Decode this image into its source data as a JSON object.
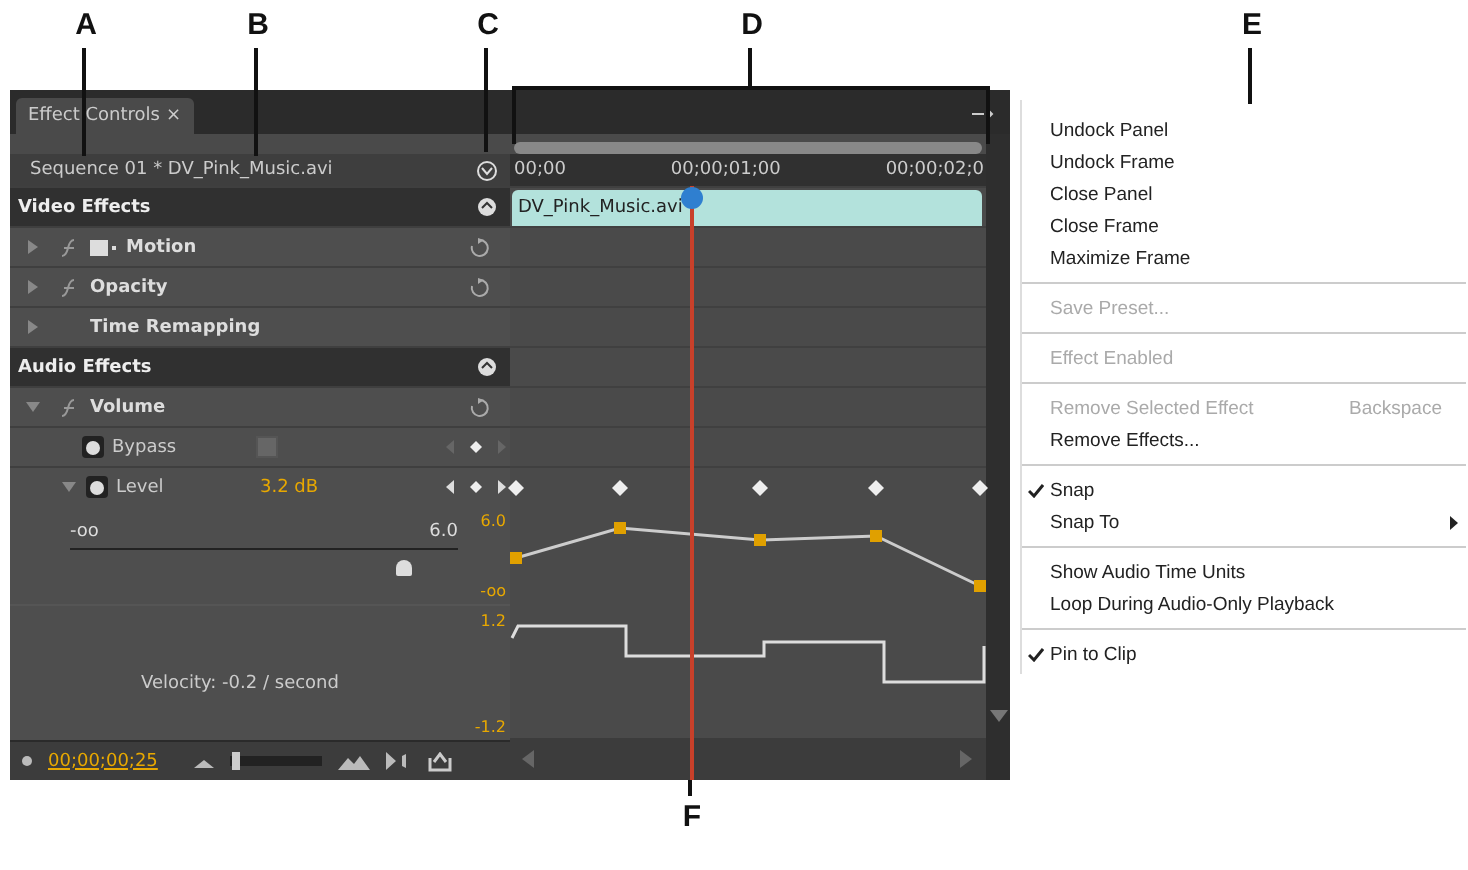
{
  "callouts": [
    {
      "label": "A"
    },
    {
      "label": "B"
    },
    {
      "label": "C"
    },
    {
      "label": "D"
    },
    {
      "label": "E"
    },
    {
      "label": "F"
    }
  ],
  "panel": {
    "tab": {
      "label": "Effect Controls",
      "close": "×",
      "selected": true
    },
    "source": "Sequence 01 * DV_Pink_Music.avi",
    "rows": [
      {
        "kind": "section",
        "label": "Video Effects"
      },
      {
        "kind": "effect",
        "label": "Motion",
        "expanded": false,
        "fx": true,
        "transform": true,
        "reset": true
      },
      {
        "kind": "effect",
        "label": "Opacity",
        "expanded": false,
        "fx": true,
        "transform": false,
        "reset": true
      },
      {
        "kind": "effect",
        "label": "Time Remapping",
        "expanded": false,
        "fx": false,
        "transform": false,
        "reset": false
      },
      {
        "kind": "section",
        "label": "Audio Effects"
      },
      {
        "kind": "effect",
        "label": "Volume",
        "expanded": true,
        "fx": true,
        "transform": false,
        "reset": true
      },
      {
        "kind": "checkbox",
        "label": "Bypass",
        "checked": false
      },
      {
        "kind": "param",
        "label": "Level",
        "value": "3.2 dB",
        "expanded": true
      }
    ],
    "slider": {
      "min": "-oo",
      "max": "6.0",
      "level": 0.86
    },
    "scale": {
      "value_max": "6.0",
      "value_min": "-oo",
      "velocity_max": "1.2",
      "velocity_min": "-1.2"
    },
    "velocity": "Velocity: -0.2 / second",
    "timecode": "00;00;00;25",
    "zoom": {
      "level": 0.03
    },
    "timeline": {
      "ruler": [
        "00;00",
        "00;00;01;00",
        "00;00;02;0"
      ],
      "clip": "DV_Pink_Music.avi"
    }
  },
  "menu": {
    "groups": [
      [
        {
          "label": "Undock Panel",
          "disabled": false,
          "checked": false
        },
        {
          "label": "Undock Frame",
          "disabled": false,
          "checked": false
        },
        {
          "label": "Close Panel",
          "disabled": false,
          "checked": false
        },
        {
          "label": "Close Frame",
          "disabled": false,
          "checked": false
        },
        {
          "label": "Maximize Frame",
          "disabled": false,
          "checked": false
        }
      ],
      [
        {
          "label": "Save Preset...",
          "disabled": true,
          "checked": false
        }
      ],
      [
        {
          "label": "Effect Enabled",
          "disabled": true,
          "checked": false
        }
      ],
      [
        {
          "label": "Remove Selected Effect",
          "disabled": true,
          "checked": false,
          "shortcut": "Backspace"
        },
        {
          "label": "Remove Effects...",
          "disabled": false,
          "checked": false
        }
      ],
      [
        {
          "label": "Snap",
          "disabled": false,
          "checked": true
        },
        {
          "label": "Snap To",
          "disabled": false,
          "checked": false,
          "submenu": true
        }
      ],
      [
        {
          "label": "Show Audio Time Units",
          "disabled": false,
          "checked": false
        },
        {
          "label": "Loop During Audio-Only Playback",
          "disabled": false,
          "checked": false
        }
      ],
      [
        {
          "label": "Pin to Clip",
          "disabled": false,
          "checked": true
        }
      ]
    ]
  }
}
